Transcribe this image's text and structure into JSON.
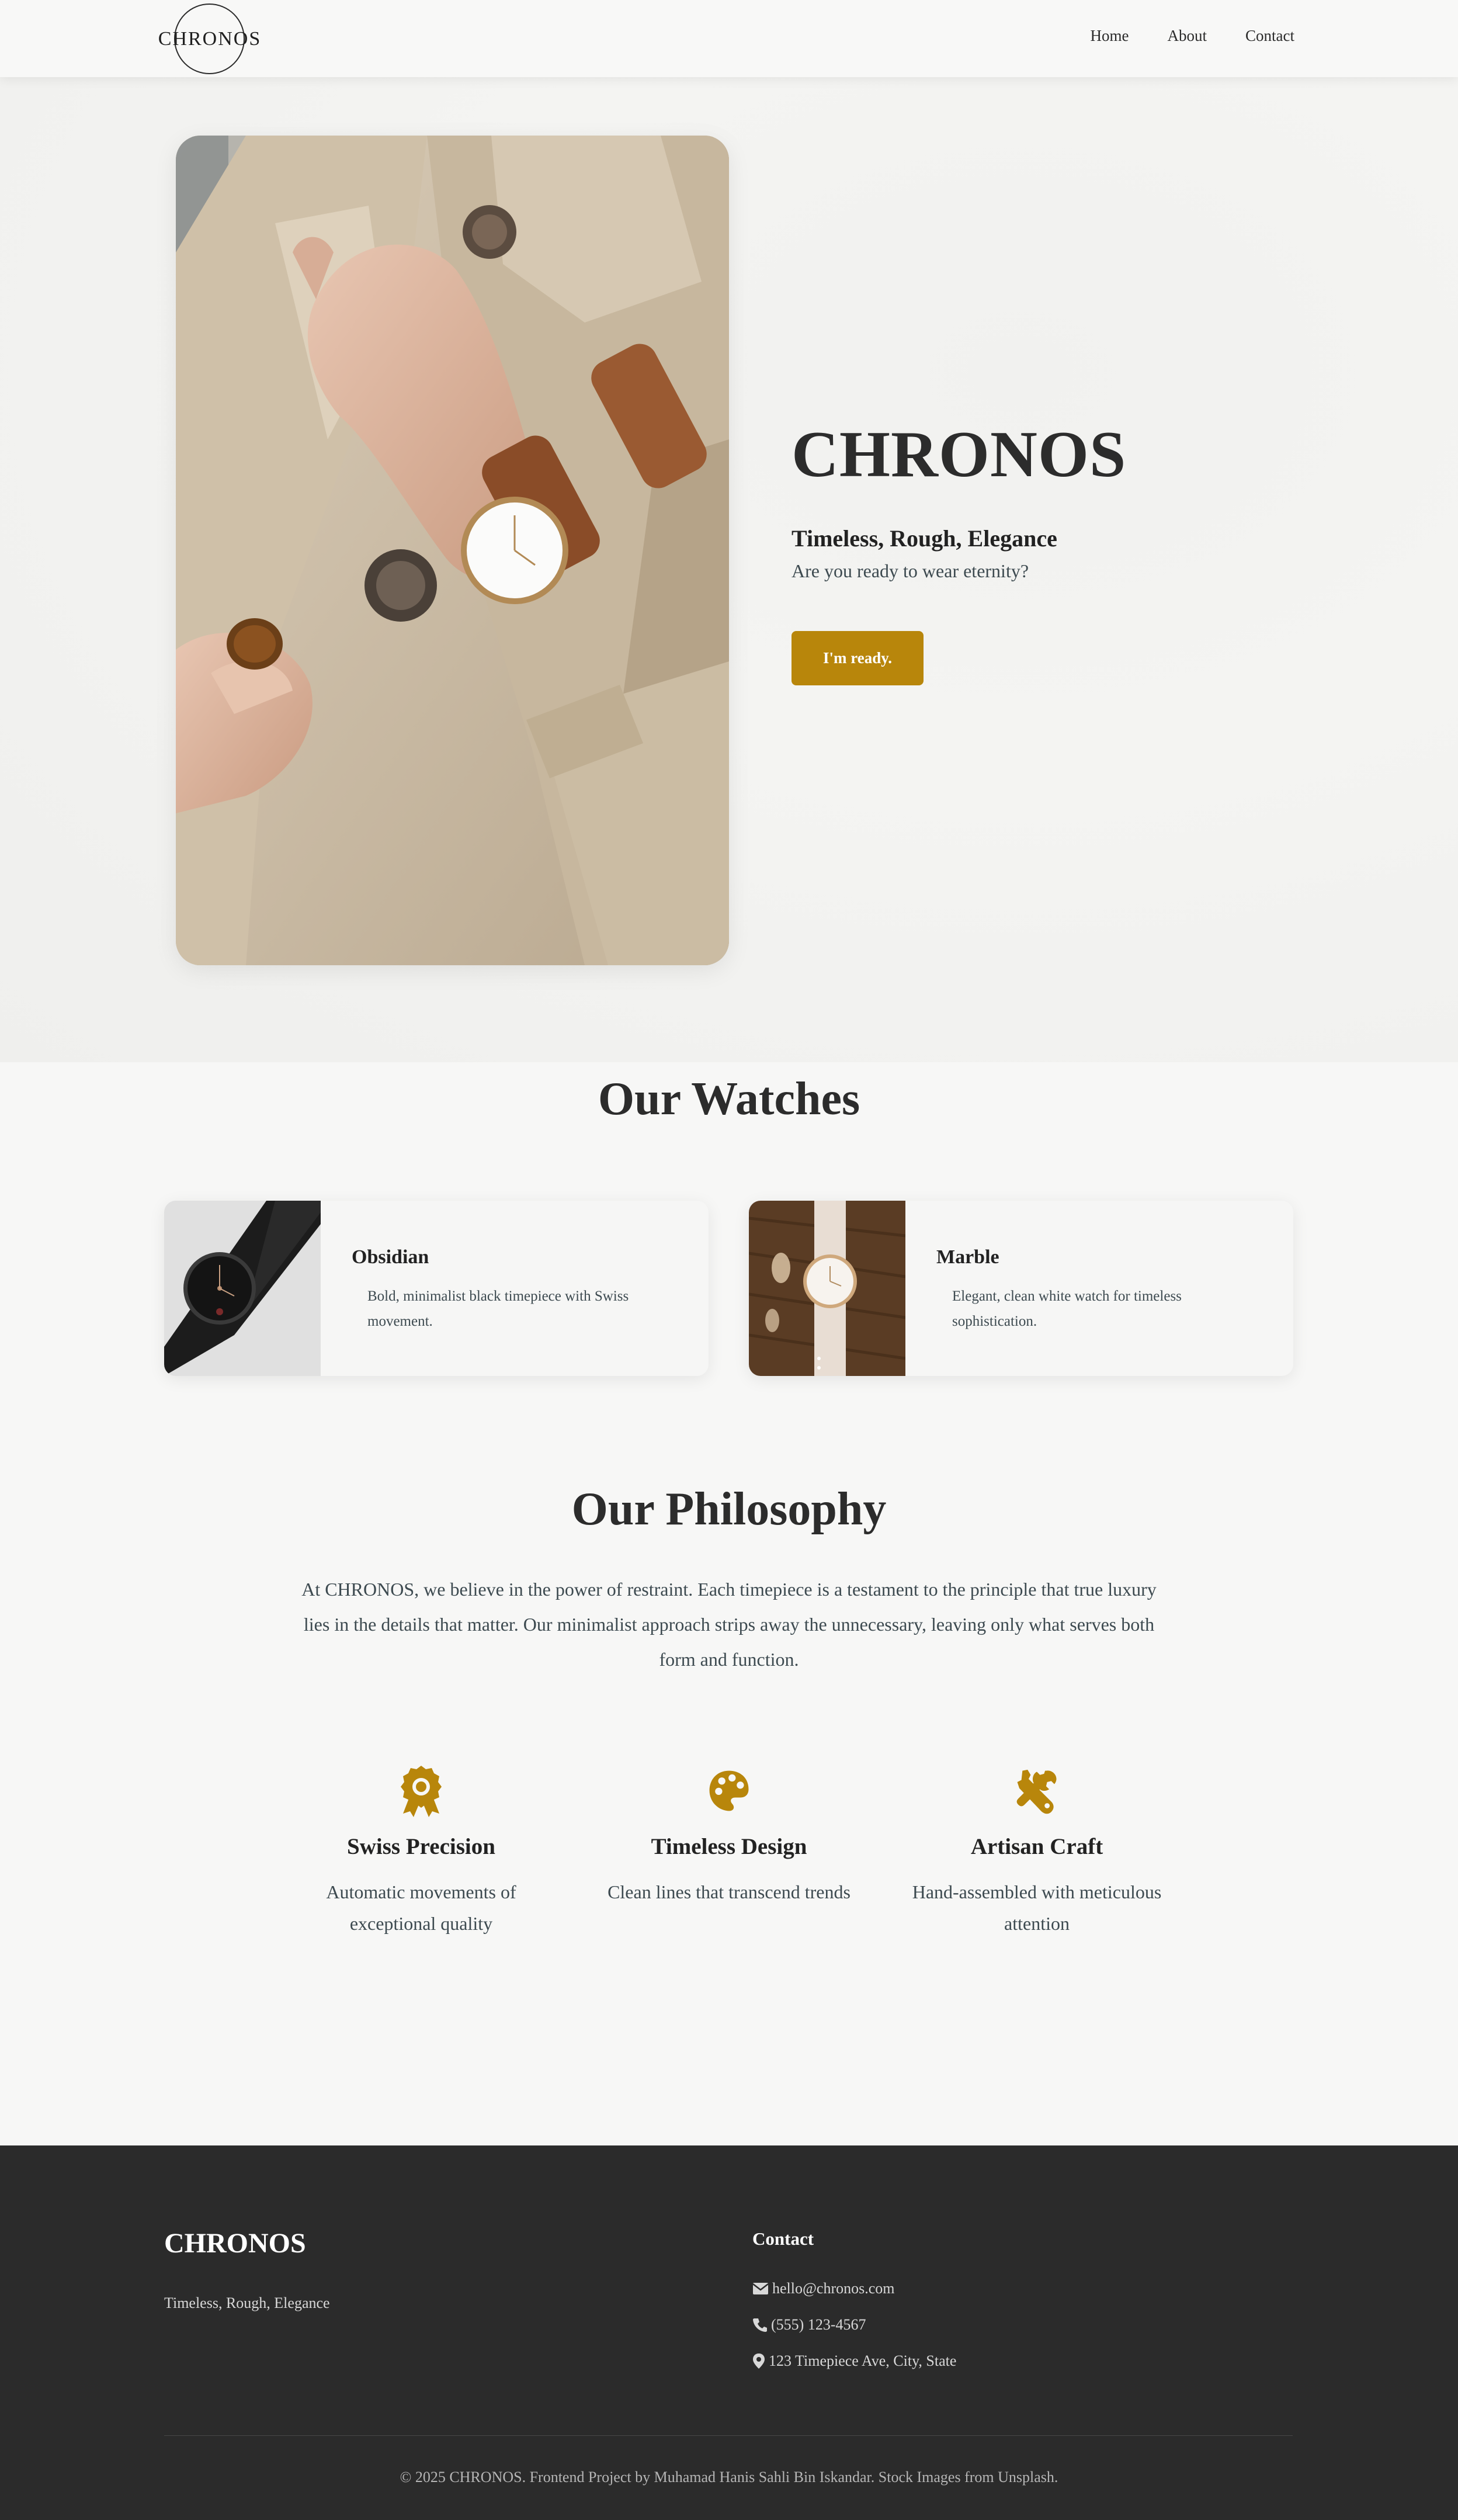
{
  "brand": {
    "logo_text": "CHRONOS"
  },
  "nav": {
    "items": [
      "Home",
      "About",
      "Contact"
    ]
  },
  "hero": {
    "title": "CHRONOS",
    "tagline": "Timeless, Rough, Elegance",
    "question": "Are you ready to wear eternity?",
    "button_label": "I'm ready.",
    "image_icon": "watch-on-wrist-photo"
  },
  "watches": {
    "title": "Our Watches",
    "items": [
      {
        "name": "Obsidian",
        "description": "Bold, minimalist black timepiece with Swiss movement.",
        "image": "black-watch-photo"
      },
      {
        "name": "Marble",
        "description": "Elegant, clean white watch for timeless sophistication.",
        "image": "white-watch-photo"
      }
    ]
  },
  "philosophy": {
    "title": "Our Philosophy",
    "text": "At CHRONOS, we believe in the power of restraint. Each timepiece is a testament to the principle that true luxury lies in the details that matter. Our minimalist approach strips away the unnecessary, leaving only what serves both form and function.",
    "features": [
      {
        "icon": "award-icon",
        "title": "Swiss Precision",
        "description": "Automatic movements of exceptional quality"
      },
      {
        "icon": "palette-icon",
        "title": "Timeless Design",
        "description": "Clean lines that transcend trends"
      },
      {
        "icon": "tools-icon",
        "title": "Artisan Craft",
        "description": "Hand-assembled with meticulous attention"
      }
    ]
  },
  "footer": {
    "brand": "CHRONOS",
    "tagline": "Timeless, Rough, Elegance",
    "contact_title": "Contact",
    "contacts": [
      {
        "icon": "envelope-icon",
        "text": "hello@chronos.com"
      },
      {
        "icon": "phone-icon",
        "text": "(555) 123-4567"
      },
      {
        "icon": "map-marker-icon",
        "text": "123 Timepiece Ave, City, State"
      }
    ],
    "copyright": "© 2025 CHRONOS. Frontend Project by Muhamad Hanis Sahli Bin Iskandar. Stock Images from Unsplash."
  },
  "colors": {
    "accent": "#b8860b",
    "dark": "#2b2b2b",
    "background": "#f7f7f6"
  }
}
